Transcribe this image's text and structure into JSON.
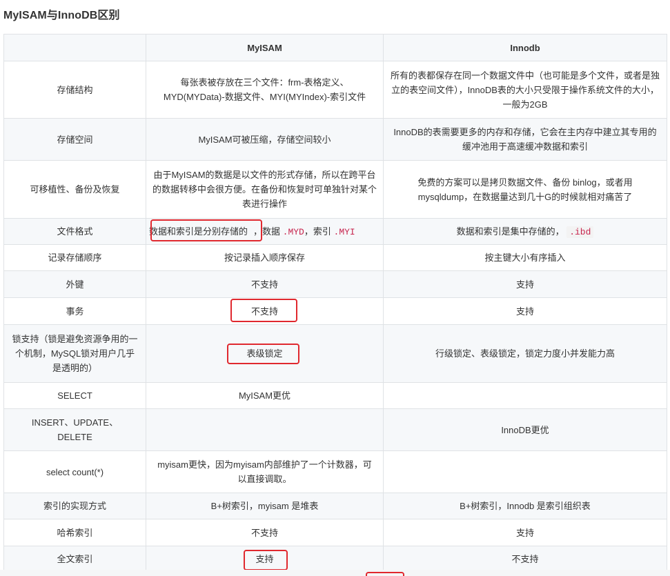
{
  "title": "MyISAM与InnoDB区别",
  "headers": [
    "",
    "MyISAM",
    "Innodb"
  ],
  "rows": [
    {
      "feature": "存储结构",
      "myisam": "每张表被存放在三个文件：frm-表格定义、MYD(MYData)-数据文件、MYI(MYIndex)-索引文件",
      "innodb": "所有的表都保存在同一个数据文件中（也可能是多个文件，或者是独立的表空间文件），InnoDB表的大小只受限于操作系统文件的大小，一般为2GB"
    },
    {
      "feature": "存储空间",
      "myisam": "MyISAM可被压缩，存储空间较小",
      "innodb": "InnoDB的表需要更多的内存和存储，它会在主内存中建立其专用的缓冲池用于高速缓冲数据和索引"
    },
    {
      "feature": "可移植性、备份及恢复",
      "myisam": "由于MyISAM的数据是以文件的形式存储，所以在跨平台的数据转移中会很方便。在备份和恢复时可单独针对某个表进行操作",
      "innodb": "免费的方案可以是拷贝数据文件、备份 binlog，或者用 mysqldump，在数据量达到几十G的时候就相对痛苦了"
    },
    {
      "feature": "文件格式",
      "myisam_a": "数据和索引是分别存储的",
      "myisam_b": "，数据",
      "myisam_code1": ".MYD",
      "myisam_c": "，索引",
      "myisam_code2": ".MYI",
      "innodb_a": "数据和索引是集中存储的，",
      "innodb_code": ".ibd"
    },
    {
      "feature": "记录存储顺序",
      "myisam": "按记录插入顺序保存",
      "innodb": "按主键大小有序插入"
    },
    {
      "feature": "外键",
      "myisam": "不支持",
      "innodb": "支持"
    },
    {
      "feature": "事务",
      "myisam": "不支持",
      "innodb": "支持"
    },
    {
      "feature": "锁支持（锁是避免资源争用的一个机制，MySQL锁对用户几乎是透明的）",
      "myisam": "表级锁定",
      "innodb": "行级锁定、表级锁定，锁定力度小并发能力高"
    },
    {
      "feature": "SELECT",
      "myisam": "MyISAM更优",
      "innodb": ""
    },
    {
      "feature": "INSERT、UPDATE、DELETE",
      "myisam": "",
      "innodb": "InnoDB更优"
    },
    {
      "feature": "select count(*)",
      "myisam": "myisam更快，因为myisam内部维护了一个计数器，可以直接调取。",
      "innodb": ""
    },
    {
      "feature": "索引的实现方式",
      "myisam": "B+树索引，myisam 是堆表",
      "innodb": "B+树索引，Innodb 是索引组织表"
    },
    {
      "feature": "哈希索引",
      "myisam": "不支持",
      "innodb": "支持"
    },
    {
      "feature": "全文索引",
      "myisam": "支持",
      "innodb": "不支持"
    }
  ],
  "colors": {
    "highlight": "#e0282e",
    "code": "#c7254e",
    "border": "#dfe2e5",
    "stripe": "#f6f8fa"
  }
}
